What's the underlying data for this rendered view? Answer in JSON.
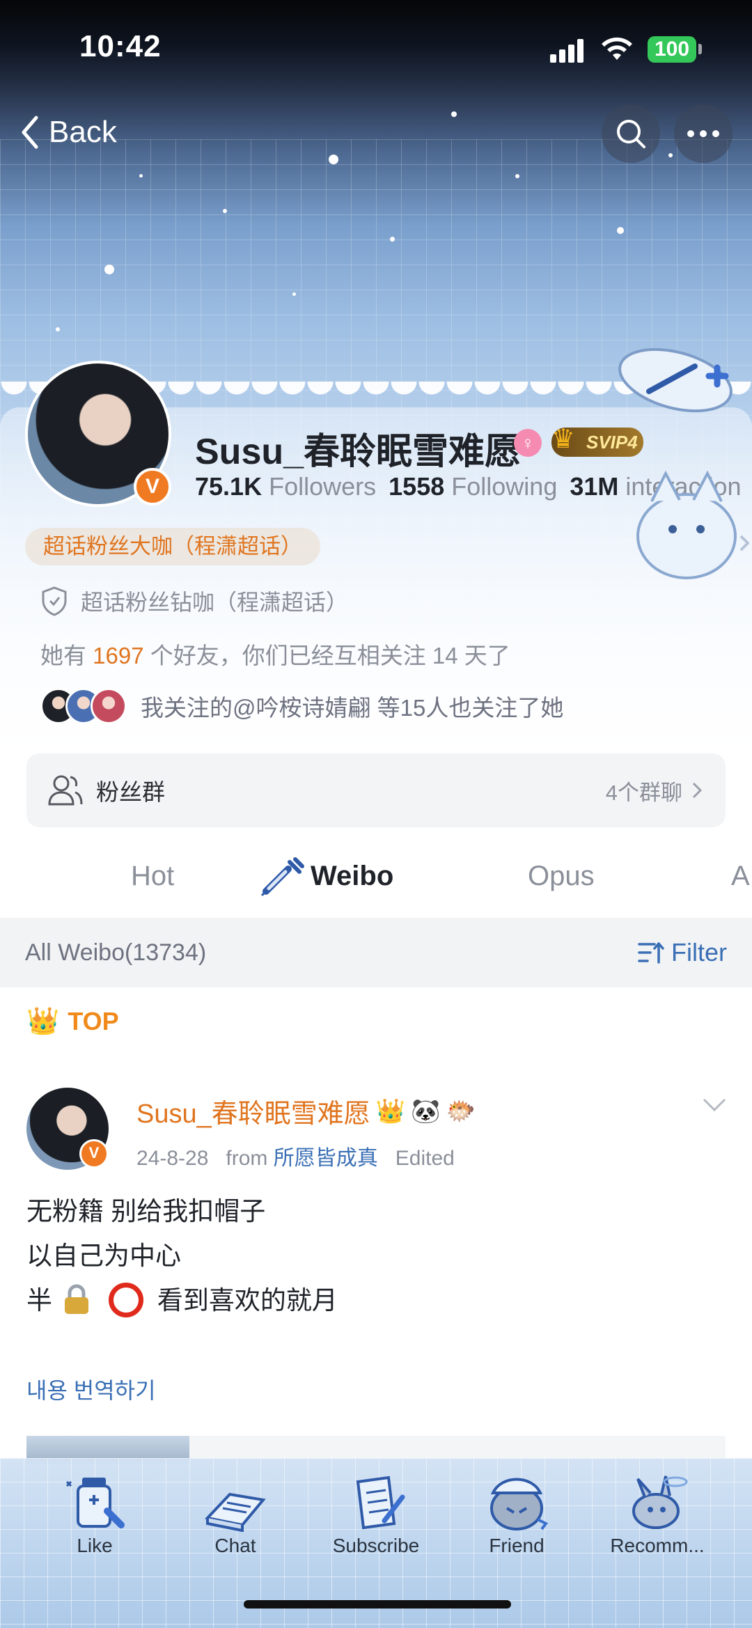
{
  "status_bar": {
    "time": "10:42",
    "battery": "100"
  },
  "nav": {
    "back_label": "Back"
  },
  "profile": {
    "username": "Susu_春聆眠雪难愿",
    "svip": "SVIP4",
    "followers_count": "75.1K",
    "followers_label": "Followers",
    "following_count": "1558",
    "following_label": "Following",
    "interaction_count": "31M",
    "interaction_label": "interaction",
    "chip_label": "超话粉丝大咖（程潇超话）",
    "diamond_label": "超话粉丝钻咖（程潇超话）",
    "friends_prefix": "她有",
    "friends_count": "1697",
    "friends_suffix": "个好友，你们已经互相关注 14 天了",
    "mutual_text": "我关注的@吟桉诗婧翩 等15人也关注了她"
  },
  "fans_group": {
    "title": "粉丝群",
    "count": "4个群聊"
  },
  "tabs": [
    {
      "label": "Hot"
    },
    {
      "label": "Weibo"
    },
    {
      "label": "Opus"
    },
    {
      "label": "A"
    }
  ],
  "filter_bar": {
    "all_label": "All Weibo(13734)",
    "filter_label": "Filter"
  },
  "top_label": "TOP",
  "post": {
    "author": "Susu_春聆眠雪难愿",
    "date": "24-8-28",
    "from_label": "from",
    "source": "所愿皆成真",
    "edited": "Edited",
    "line1": "无粉籍 别给我扣帽子",
    "line2": "以自己为中心",
    "line3_prefix": "半",
    "line3_suffix": "看到喜欢的就月",
    "translate": "내용 번역하기"
  },
  "bottom_tabs": [
    {
      "label": "Like",
      "icon": "medicine-bottle-icon"
    },
    {
      "label": "Chat",
      "icon": "book-icon"
    },
    {
      "label": "Subscribe",
      "icon": "notebook-pen-icon"
    },
    {
      "label": "Friend",
      "icon": "bandaged-pet-icon"
    },
    {
      "label": "Recomm...",
      "icon": "bandaged-bunny-icon"
    }
  ],
  "colors": {
    "accent_orange": "#e0751f",
    "link_blue": "#3a6fb5",
    "verified_orange": "#f07a22"
  }
}
